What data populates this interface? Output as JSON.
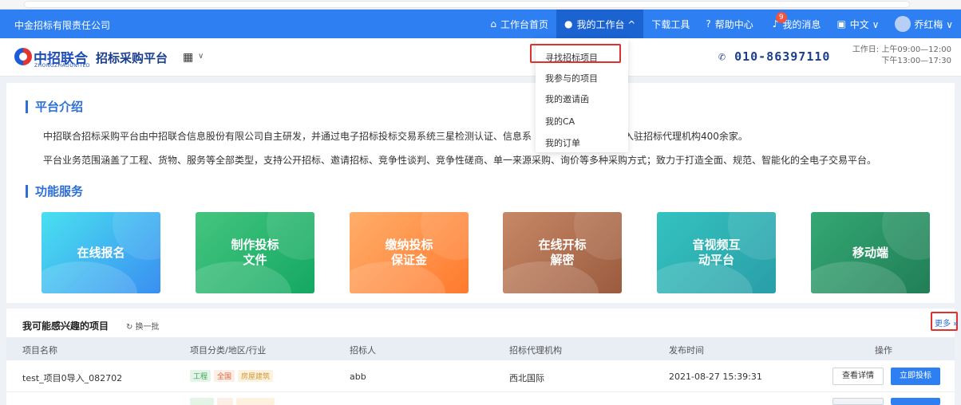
{
  "topbar": {
    "company": "中金招标有限责任公司",
    "nav": [
      {
        "label": "工作台首页",
        "icon": "home-icon"
      },
      {
        "label": "我的工作台 ^",
        "icon": "user-icon"
      },
      {
        "label": "下载工具",
        "icon": ""
      },
      {
        "label": "帮助中心",
        "icon": "help-icon"
      },
      {
        "label": "我的消息",
        "icon": "bell-icon",
        "badge": "9"
      },
      {
        "label": "中文 ∨",
        "icon": "translate-icon"
      },
      {
        "label": "乔红梅 ∨",
        "icon": "avatar"
      }
    ]
  },
  "header": {
    "logo_main": "中招联合",
    "logo_sub": "ZHONGZHAOUNITED",
    "logo_title": "招标采购平台",
    "phone": "010-86397110",
    "hours_line1": "工作日: 上午09:00—12:00",
    "hours_line2": "下午13:00—17:30"
  },
  "dropdown": {
    "items": [
      "寻找招标项目",
      "我参与的项目",
      "我的邀请函",
      "我的CA",
      "我的订单"
    ]
  },
  "intro": {
    "title": "平台介绍",
    "para1_a": "中招联合招标采购平台由中招联合信息股份有限公司自主研发，并通过电子招标投标交易系统三星检测认证、信息系",
    "para1_b": "已入驻招标代理机构400余家。",
    "para2_a": "平台业务范围涵盖了工程、货物、服务等全部类型，支持公开招标、邀请招标、竞争性谈判、竞争性磋商、单一来源采购、询价等多种采购方式；致力于打造全面、规范、智能化的全电",
    "para2_b": "子交易平台。"
  },
  "services": {
    "title": "功能服务",
    "tiles": [
      "在线报名",
      "制作投标\n文件",
      "缴纳投标\n保证金",
      "在线开标\n解密",
      "音视频互\n动平台",
      "移动端"
    ]
  },
  "projects": {
    "title": "我可能感兴趣的项目",
    "refresh": "换一批",
    "more": "更多 »",
    "headers": [
      "项目名称",
      "项目分类/地区/行业",
      "招标人",
      "招标代理机构",
      "发布时间",
      "操作"
    ],
    "rows": [
      {
        "name": "test_项目0导入_082702",
        "tags": [
          "工程",
          "全国",
          "房屋建筑"
        ],
        "tenderer": "abb",
        "agency": "西北国际",
        "time": "2021-08-27 15:39:31",
        "detail": "查看详情",
        "bid": "立即投标"
      }
    ]
  }
}
